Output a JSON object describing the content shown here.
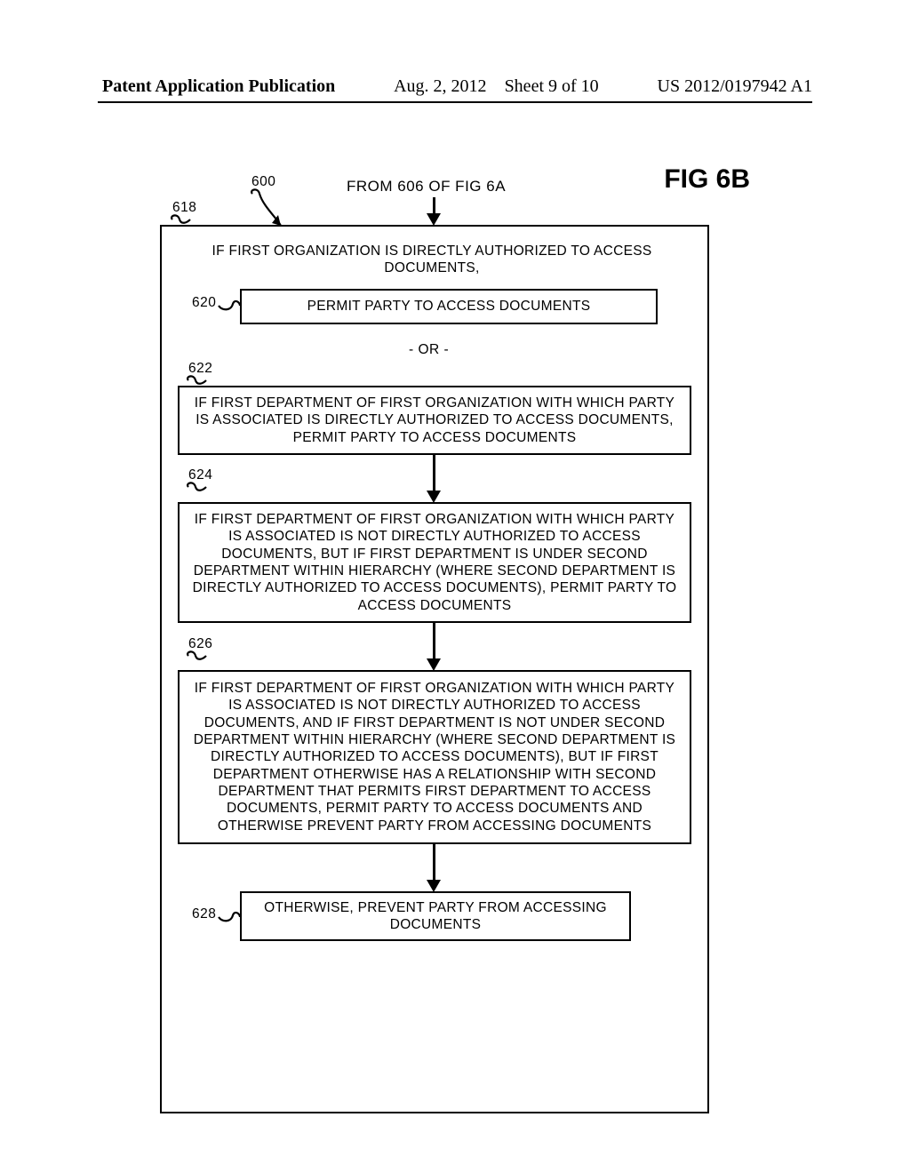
{
  "header": {
    "left": "Patent Application Publication",
    "date": "Aug. 2, 2012",
    "sheet": "Sheet 9 of 10",
    "pubnum": "US 2012/0197942 A1"
  },
  "figure": {
    "title": "FIG 6B",
    "from": "FROM 606 OF FIG 6A"
  },
  "refs": {
    "r600": "600",
    "r618": "618",
    "r620": "620",
    "r622": "622",
    "r624": "624",
    "r626": "626",
    "r628": "628"
  },
  "text": {
    "b618": "IF FIRST ORGANIZATION IS DIRECTLY AUTHORIZED TO ACCESS DOCUMENTS,",
    "b620": "PERMIT PARTY TO ACCESS DOCUMENTS",
    "or": "- OR -",
    "b622": "IF FIRST DEPARTMENT OF FIRST ORGANIZATION WITH WHICH PARTY IS ASSOCIATED IS DIRECTLY AUTHORIZED TO ACCESS DOCUMENTS, PERMIT PARTY TO ACCESS DOCUMENTS",
    "b624": "IF FIRST DEPARTMENT OF FIRST ORGANIZATION WITH WHICH PARTY IS ASSOCIATED IS NOT DIRECTLY AUTHORIZED TO ACCESS DOCUMENTS, BUT IF FIRST DEPARTMENT IS UNDER SECOND DEPARTMENT WITHIN HIERARCHY (WHERE SECOND DEPARTMENT IS DIRECTLY AUTHORIZED TO ACCESS DOCUMENTS), PERMIT PARTY TO ACCESS DOCUMENTS",
    "b626": "IF FIRST DEPARTMENT OF FIRST ORGANIZATION WITH WHICH PARTY IS ASSOCIATED IS NOT DIRECTLY AUTHORIZED TO ACCESS DOCUMENTS, AND IF FIRST DEPARTMENT IS NOT UNDER SECOND DEPARTMENT WITHIN HIERARCHY (WHERE SECOND DEPARTMENT IS DIRECTLY AUTHORIZED TO ACCESS DOCUMENTS), BUT IF FIRST DEPARTMENT OTHERWISE HAS A RELATIONSHIP WITH SECOND DEPARTMENT THAT PERMITS FIRST DEPARTMENT TO ACCESS DOCUMENTS, PERMIT PARTY TO ACCESS DOCUMENTS AND OTHERWISE PREVENT PARTY FROM ACCESSING DOCUMENTS",
    "b628": "OTHERWISE, PREVENT PARTY FROM ACCESSING DOCUMENTS"
  }
}
